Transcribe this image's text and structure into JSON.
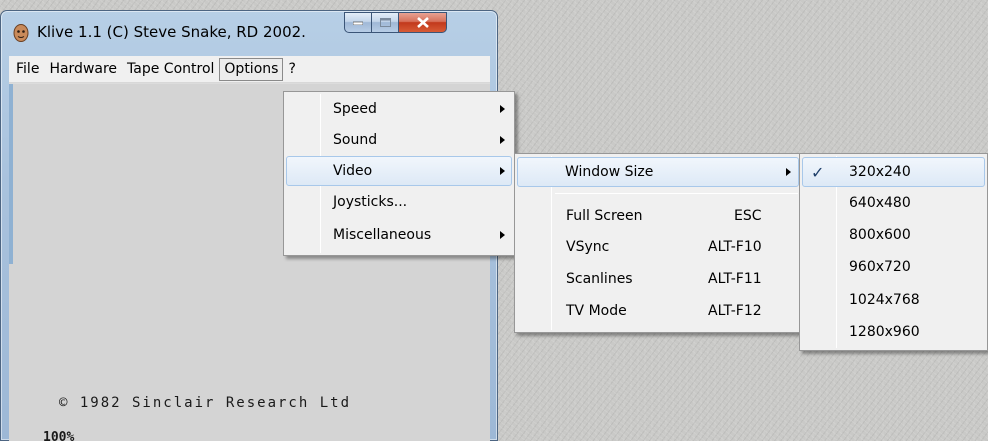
{
  "window": {
    "title": "Klive 1.1 (C) Steve Snake, RD 2002."
  },
  "menubar": {
    "items": [
      "File",
      "Hardware",
      "Tape Control",
      "Options",
      "?"
    ]
  },
  "screen": {
    "copyright": "© 1982 Sinclair Research Ltd",
    "zoom": "100%"
  },
  "options_menu": {
    "items": [
      {
        "label": "Speed",
        "submenu": true
      },
      {
        "label": "Sound",
        "submenu": true
      },
      {
        "label": "Video",
        "submenu": true,
        "highlighted": true
      },
      {
        "label": "Joysticks...",
        "submenu": false
      },
      {
        "label": "Miscellaneous",
        "submenu": true
      }
    ]
  },
  "video_menu": {
    "items": [
      {
        "label": "Window Size",
        "shortcut": "",
        "submenu": true,
        "highlighted": true
      },
      {
        "label": "Full Screen",
        "shortcut": "ESC"
      },
      {
        "label": "VSync",
        "shortcut": "ALT-F10"
      },
      {
        "label": "Scanlines",
        "shortcut": "ALT-F11"
      },
      {
        "label": "TV Mode",
        "shortcut": "ALT-F12"
      }
    ]
  },
  "window_size_menu": {
    "items": [
      {
        "label": "320x240",
        "checked": true,
        "highlighted": true
      },
      {
        "label": "640x480"
      },
      {
        "label": "800x600"
      },
      {
        "label": "960x720"
      },
      {
        "label": "1024x768"
      },
      {
        "label": "1280x960"
      }
    ]
  },
  "colors": {
    "highlight_border": "#a8c8ea",
    "menu_bg": "#f0f0f0",
    "titlebar": "#b7cfe6",
    "close_button": "#c2391c"
  }
}
